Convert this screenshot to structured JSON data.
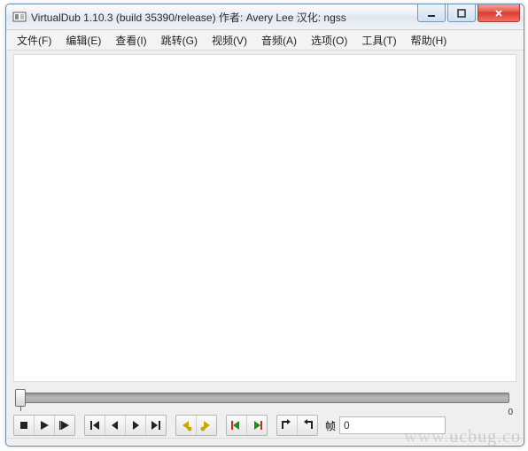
{
  "window": {
    "title": "VirtualDub 1.10.3 (build 35390/release) 作者: Avery Lee  汉化: ngss"
  },
  "menu": {
    "items": [
      {
        "label": "文件(F)"
      },
      {
        "label": "编辑(E)"
      },
      {
        "label": "查看(I)"
      },
      {
        "label": "跳转(G)"
      },
      {
        "label": "视频(V)"
      },
      {
        "label": "音频(A)"
      },
      {
        "label": "选项(O)"
      },
      {
        "label": "工具(T)"
      },
      {
        "label": "帮助(H)"
      }
    ]
  },
  "scrubber": {
    "end_label": "0"
  },
  "toolbar": {
    "frame_label": "帧",
    "frame_value": "0"
  },
  "watermark": {
    "text_faded": "www.",
    "text": "ucbug.co"
  }
}
